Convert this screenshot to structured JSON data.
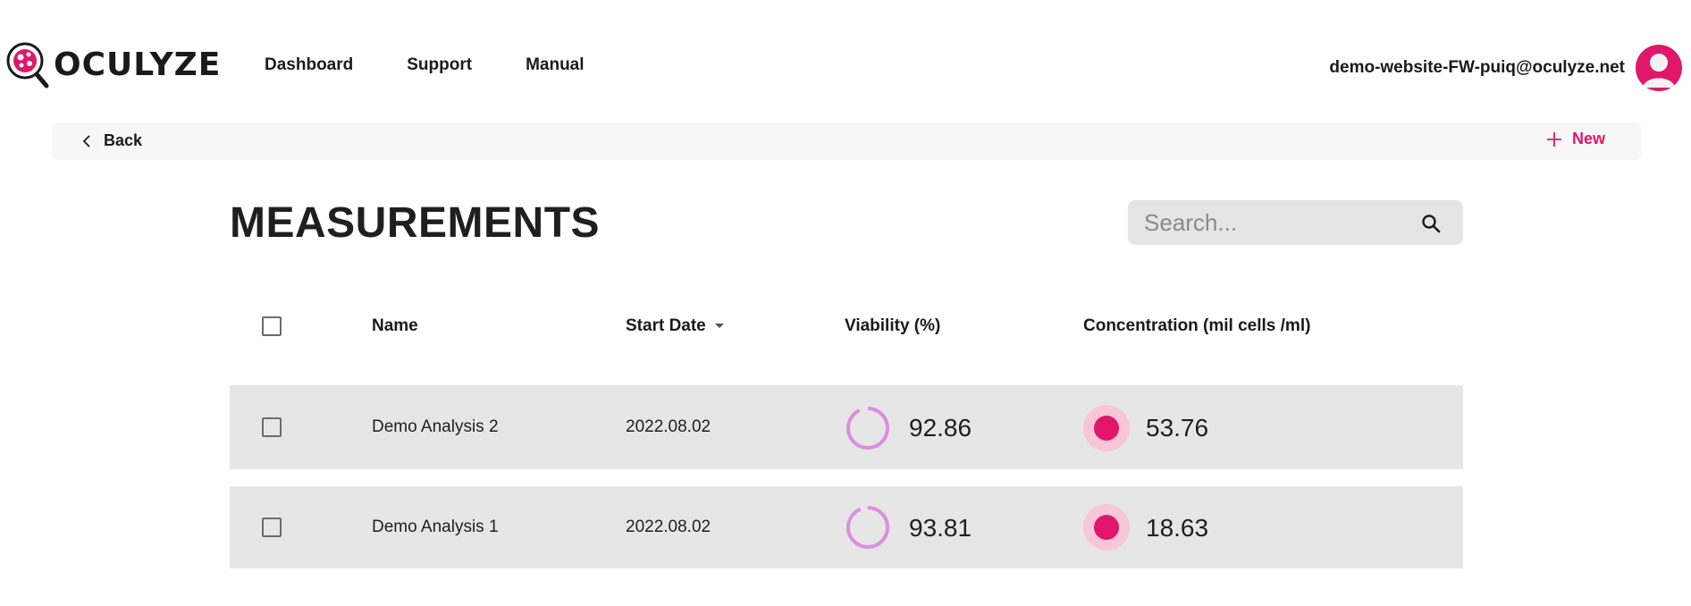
{
  "brand": {
    "name": "OCULYZE",
    "accent": "#e0176b"
  },
  "nav": {
    "items": [
      "Dashboard",
      "Support",
      "Manual"
    ]
  },
  "user": {
    "email": "demo-website-FW-puiq@oculyze.net"
  },
  "subbar": {
    "back_label": "Back",
    "new_label": "New"
  },
  "page": {
    "title": "MEASUREMENTS"
  },
  "search": {
    "placeholder": "Search..."
  },
  "table": {
    "columns": {
      "name": "Name",
      "start_date": "Start Date",
      "viability": "Viability (%)",
      "concentration": "Concentration (mil cells /ml)"
    },
    "rows": [
      {
        "name": "Demo Analysis 2",
        "start_date": "2022.08.02",
        "viability": "92.86",
        "concentration": "53.76"
      },
      {
        "name": "Demo Analysis 1",
        "start_date": "2022.08.02",
        "viability": "93.81",
        "concentration": "18.63"
      }
    ]
  },
  "colors": {
    "viability_ring": "#dd8ee0",
    "concentration_dot": "#e0176b",
    "concentration_halo": "#f8c6d6",
    "row_bg": "#e6e6e6"
  }
}
